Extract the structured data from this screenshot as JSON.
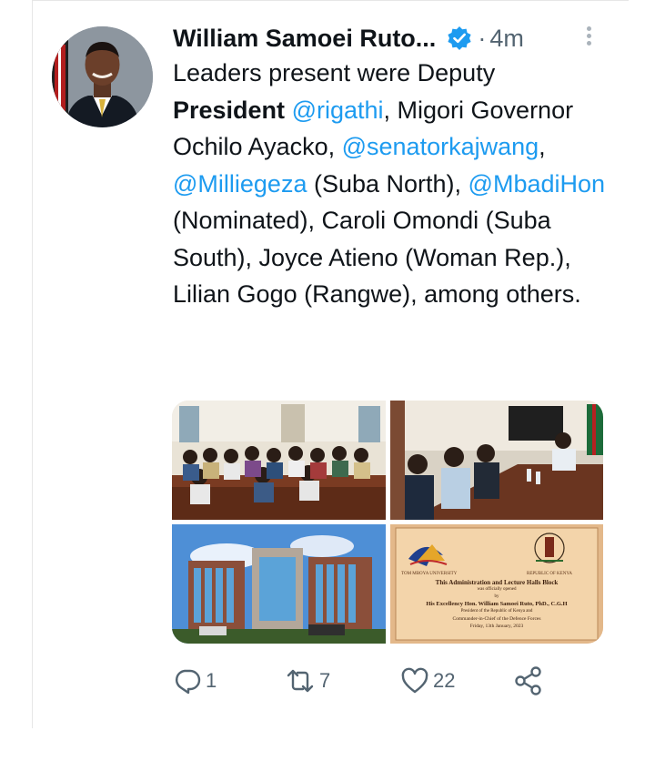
{
  "tweet": {
    "author_name": "William Samoei Ruto...",
    "verified_icon": "verified-badge-icon",
    "separator": "·",
    "time": "4m",
    "text_runs": [
      {
        "text": "Leaders present were Deputy ",
        "style": "plain"
      },
      {
        "text": "President",
        "style": "bold"
      },
      {
        "text": " ",
        "style": "plain"
      },
      {
        "text": "@rigathi",
        "style": "mention"
      },
      {
        "text": ", Migori Governor Ochilo Ayacko, ",
        "style": "plain"
      },
      {
        "text": "@senatorkajwang",
        "style": "mention"
      },
      {
        "text": ", ",
        "style": "plain"
      },
      {
        "text": "@Milliegeza",
        "style": "mention"
      },
      {
        "text": " (Suba North), ",
        "style": "plain"
      },
      {
        "text": "@MbadiHon",
        "style": "mention"
      },
      {
        "text": " (Nominated), Caroli Omondi (Suba South), Joyce Atieno (Woman Rep.), Lilian Gogo (Rangwe), among others.",
        "style": "plain"
      }
    ],
    "plaque": {
      "left_org": "TOM MBOYA UNIVERSITY",
      "right_org": "REPUBLIC OF KENYA",
      "line1": "This Administration and Lecture Halls Block",
      "line2": "was officially opened",
      "line3": "by",
      "line4": "His Excellency Hon. William Samoei Ruto, PhD., C.G.H",
      "line5": "President of the Republic of Kenya and",
      "line6": "Commander-in-Chief of the Defence Forces",
      "line7": "Friday, 13th January, 2023"
    },
    "actions": {
      "reply_icon": "reply-icon",
      "reply_count": "1",
      "retweet_icon": "retweet-icon",
      "retweet_count": "7",
      "like_icon": "heart-icon",
      "like_count": "22",
      "share_icon": "share-icon"
    },
    "colors": {
      "mention": "#1d9bf0",
      "verified": "#1d9bf0",
      "muted": "#536471"
    }
  }
}
